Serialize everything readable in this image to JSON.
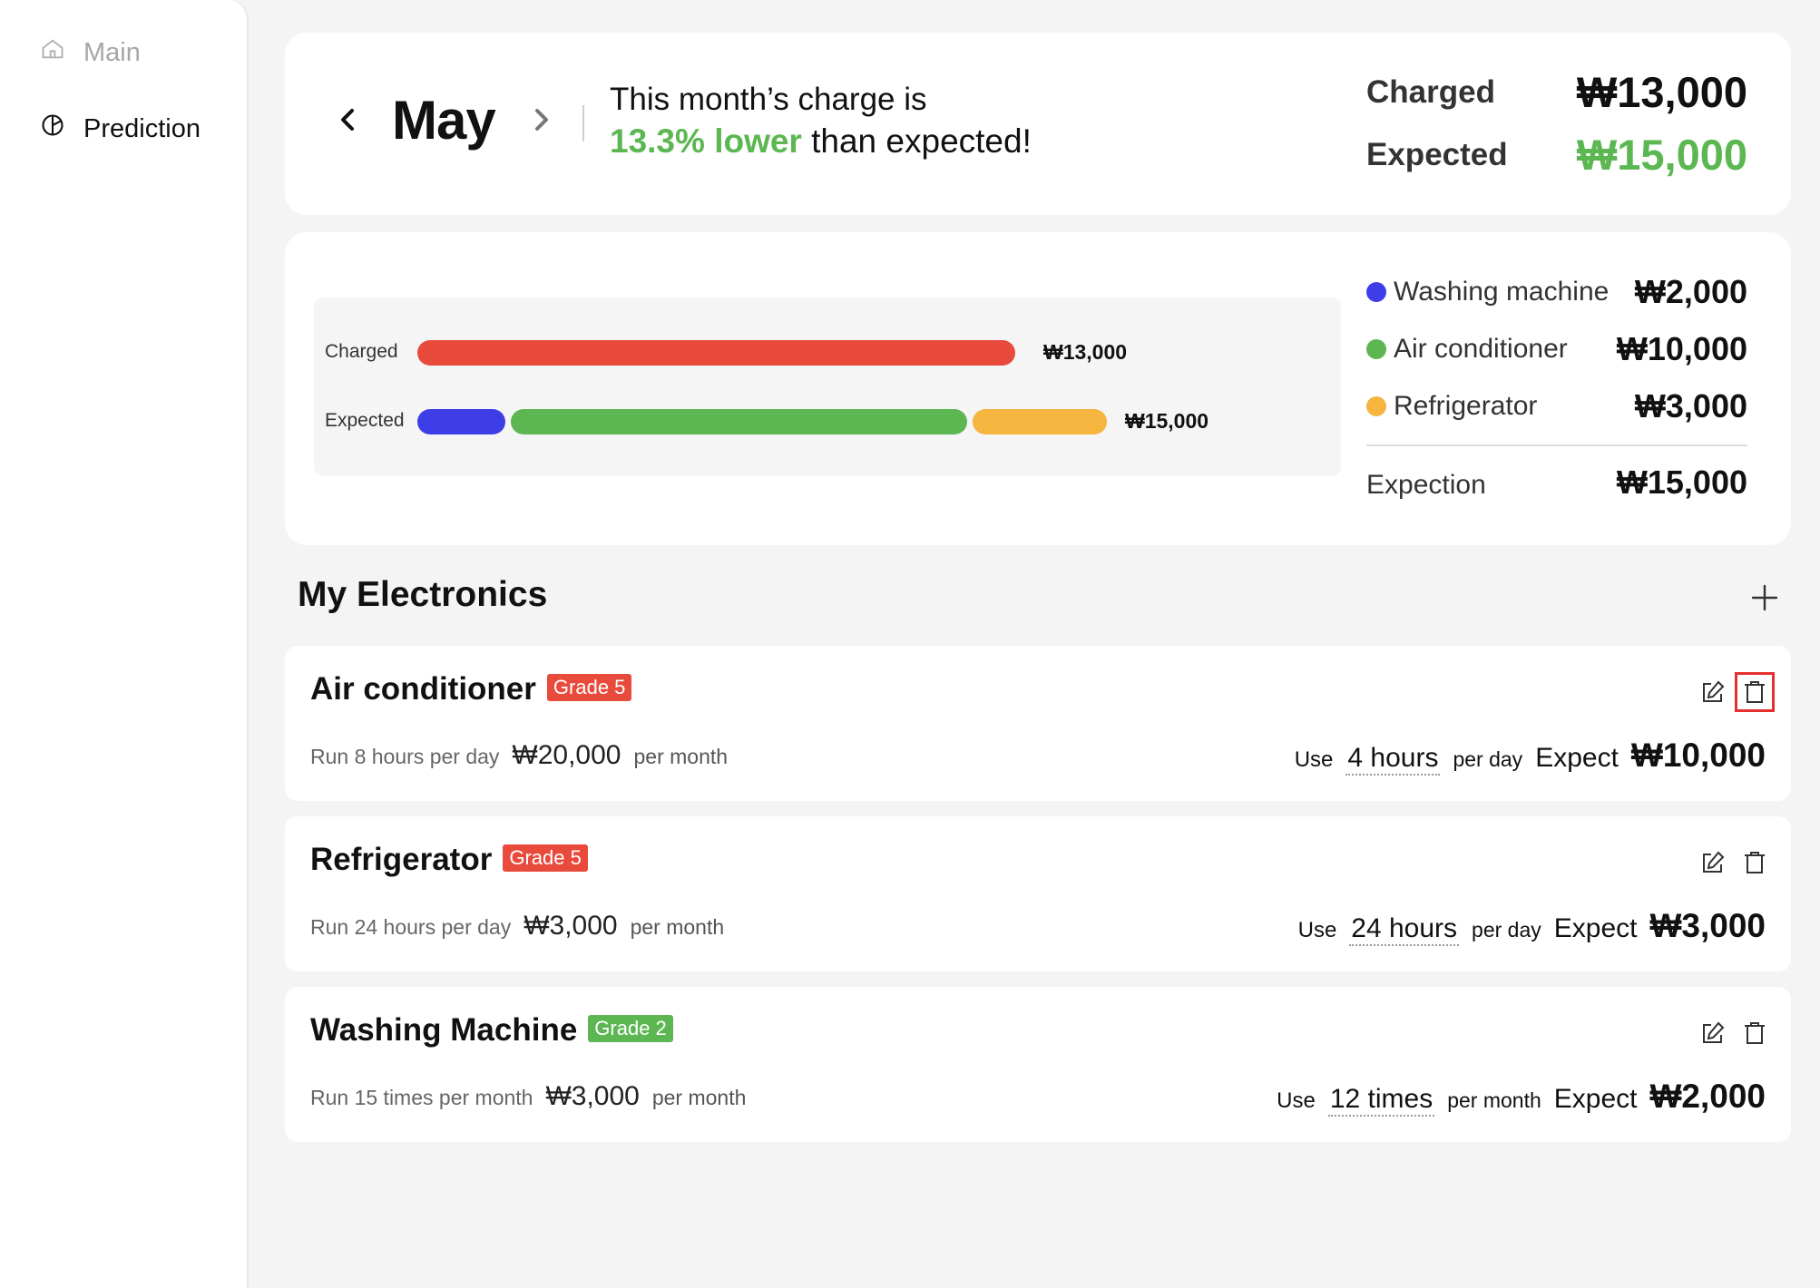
{
  "sidebar": {
    "items": [
      {
        "label": "Main",
        "icon": "home-icon",
        "active": false
      },
      {
        "label": "Prediction",
        "icon": "pie-chart-icon",
        "active": true
      }
    ]
  },
  "header": {
    "month": "May",
    "message_line1": "This month’s charge is",
    "message_highlight": "13.3% lower",
    "message_rest": " than expected!",
    "charged_label": "Charged",
    "charged_value": "₩13,000",
    "expected_label": "Expected",
    "expected_value": "₩15,000"
  },
  "colors": {
    "red": "#e84a3c",
    "green": "#5cb752",
    "blue": "#3e3ee8",
    "yellow": "#f5b53f"
  },
  "chart_data": {
    "type": "bar",
    "orientation": "horizontal",
    "stacked": true,
    "categories": [
      "Charged",
      "Expected"
    ],
    "series": [
      {
        "name": "Charged",
        "values": [
          13000,
          0
        ],
        "color": "#e84a3c"
      },
      {
        "name": "Washing machine",
        "values": [
          0,
          2000
        ],
        "color": "#3e3ee8"
      },
      {
        "name": "Air conditioner",
        "values": [
          0,
          10000
        ],
        "color": "#5cb752"
      },
      {
        "name": "Refrigerator",
        "values": [
          0,
          3000
        ],
        "color": "#f5b53f"
      }
    ],
    "totals": [
      "₩13,000",
      "₩15,000"
    ],
    "xlim": [
      0,
      15000
    ]
  },
  "legend": {
    "items": [
      {
        "name": "Washing machine",
        "value": "₩2,000",
        "color": "#3e3ee8"
      },
      {
        "name": "Air conditioner",
        "value": "₩10,000",
        "color": "#5cb752"
      },
      {
        "name": "Refrigerator",
        "value": "₩3,000",
        "color": "#f5b53f"
      }
    ],
    "total_label": "Expection",
    "total_value": "₩15,000"
  },
  "electronics": {
    "title": "My Electronics",
    "items": [
      {
        "name": "Air conditioner",
        "grade": "Grade 5",
        "grade_color": "red",
        "run_text": "Run 8 hours per day",
        "run_cost": "₩20,000",
        "per_month": "per month",
        "use_label": "Use",
        "use_value": "4 hours",
        "per_unit": "per day",
        "expect_label": "Expect",
        "expect_value": "₩10,000"
      },
      {
        "name": "Refrigerator",
        "grade": "Grade 5",
        "grade_color": "red",
        "run_text": "Run 24 hours per day",
        "run_cost": "₩3,000",
        "per_month": "per month",
        "use_label": "Use",
        "use_value": "24 hours",
        "per_unit": "per day",
        "expect_label": "Expect",
        "expect_value": "₩3,000"
      },
      {
        "name": "Washing Machine",
        "grade": "Grade 2",
        "grade_color": "green",
        "run_text": "Run 15 times per month",
        "run_cost": "₩3,000",
        "per_month": "per month",
        "use_label": "Use",
        "use_value": "12 times",
        "per_unit": "per month",
        "expect_label": "Expect",
        "expect_value": "₩2,000"
      }
    ]
  }
}
